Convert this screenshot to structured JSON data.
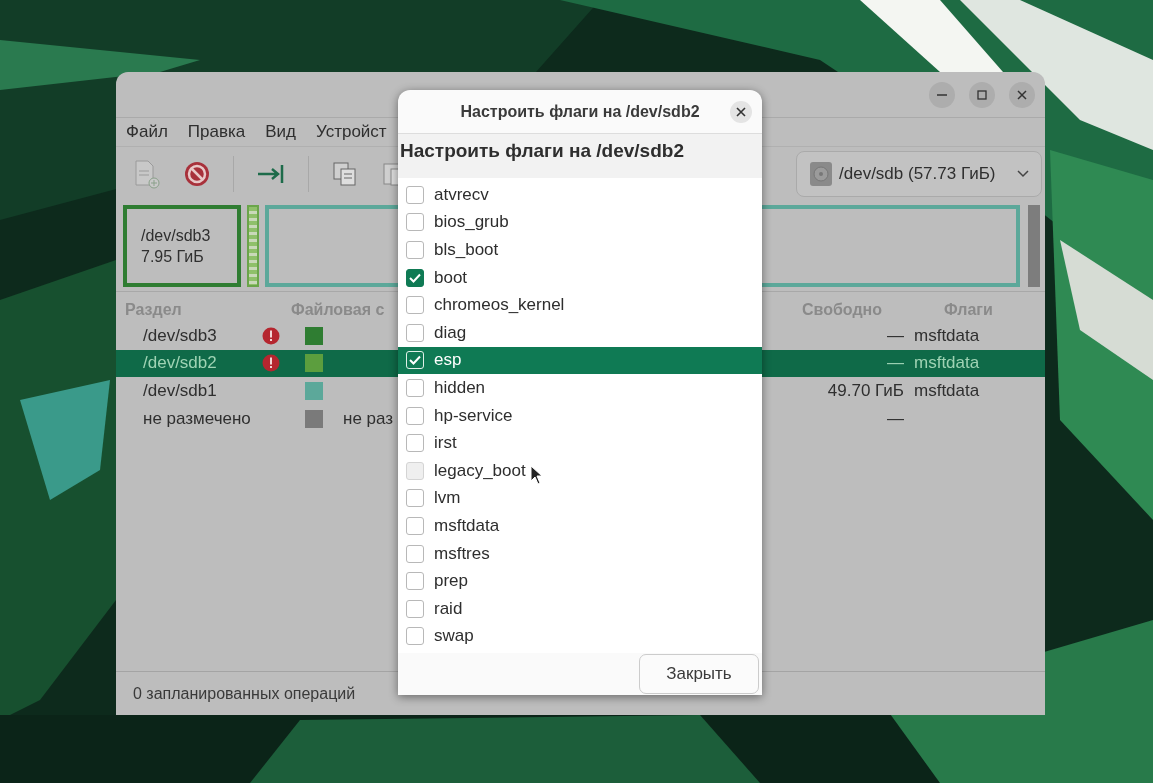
{
  "main_window": {
    "menu": [
      "Файл",
      "Правка",
      "Вид",
      "Устройст"
    ],
    "device_selector": "/dev/sdb (57.73 ГиБ)",
    "partition_map": {
      "name": "/dev/sdb3",
      "size": "7.95 ГиБ"
    },
    "partition_list": {
      "columns": [
        "Раздел",
        "Файловая с",
        "Свободно",
        "Флаги"
      ],
      "rows": [
        {
          "partition": "/dev/sdb3",
          "warning": true,
          "color": "#2f7d32",
          "filesystem": "",
          "free": "—",
          "flags": "msftdata",
          "selected": false
        },
        {
          "partition": "/dev/sdb2",
          "warning": true,
          "color": "#5c9e3e",
          "filesystem": "",
          "free": "—",
          "flags": "msftdata",
          "selected": true
        },
        {
          "partition": "/dev/sdb1",
          "warning": false,
          "color": "#5ca89a",
          "filesystem": "",
          "free": "49.70 ГиБ",
          "flags": "msftdata",
          "selected": false
        },
        {
          "partition": "не размечено",
          "warning": false,
          "color": "#7a7a7a",
          "filesystem": "не раз",
          "free": "—",
          "flags": "",
          "selected": false
        }
      ]
    },
    "status_bar": "0 запланированных операций"
  },
  "dialog": {
    "title": "Настроить флаги на /dev/sdb2",
    "heading": "Настроить флаги на /dev/sdb2",
    "flags": [
      {
        "name": "atvrecv",
        "checked": false,
        "selected": false,
        "hovered": false
      },
      {
        "name": "bios_grub",
        "checked": false,
        "selected": false,
        "hovered": false
      },
      {
        "name": "bls_boot",
        "checked": false,
        "selected": false,
        "hovered": false
      },
      {
        "name": "boot",
        "checked": true,
        "selected": false,
        "hovered": false
      },
      {
        "name": "chromeos_kernel",
        "checked": false,
        "selected": false,
        "hovered": false
      },
      {
        "name": "diag",
        "checked": false,
        "selected": false,
        "hovered": false
      },
      {
        "name": "esp",
        "checked": true,
        "selected": true,
        "hovered": false
      },
      {
        "name": "hidden",
        "checked": false,
        "selected": false,
        "hovered": false
      },
      {
        "name": "hp-service",
        "checked": false,
        "selected": false,
        "hovered": false
      },
      {
        "name": "irst",
        "checked": false,
        "selected": false,
        "hovered": false
      },
      {
        "name": "legacy_boot",
        "checked": false,
        "selected": false,
        "hovered": true
      },
      {
        "name": "lvm",
        "checked": false,
        "selected": false,
        "hovered": false
      },
      {
        "name": "msftdata",
        "checked": false,
        "selected": false,
        "hovered": false
      },
      {
        "name": "msftres",
        "checked": false,
        "selected": false,
        "hovered": false
      },
      {
        "name": "prep",
        "checked": false,
        "selected": false,
        "hovered": false
      },
      {
        "name": "raid",
        "checked": false,
        "selected": false,
        "hovered": false
      },
      {
        "name": "swap",
        "checked": false,
        "selected": false,
        "hovered": false
      }
    ],
    "close_button": "Закрыть"
  }
}
